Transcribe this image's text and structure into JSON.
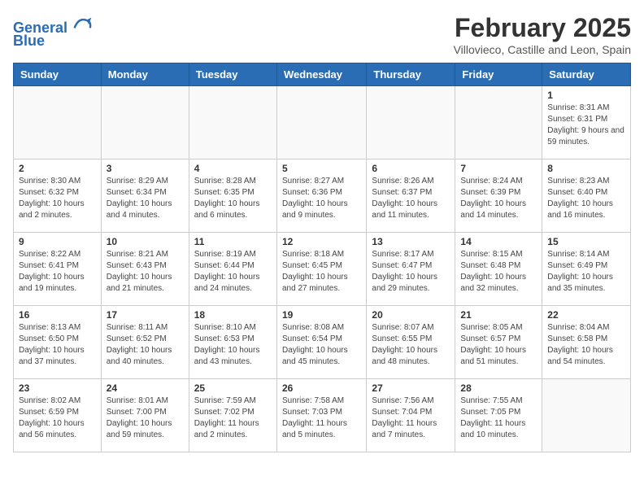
{
  "logo": {
    "line1": "General",
    "line2": "Blue"
  },
  "title": "February 2025",
  "location": "Villovieco, Castille and Leon, Spain",
  "weekdays": [
    "Sunday",
    "Monday",
    "Tuesday",
    "Wednesday",
    "Thursday",
    "Friday",
    "Saturday"
  ],
  "weeks": [
    [
      {
        "day": "",
        "info": ""
      },
      {
        "day": "",
        "info": ""
      },
      {
        "day": "",
        "info": ""
      },
      {
        "day": "",
        "info": ""
      },
      {
        "day": "",
        "info": ""
      },
      {
        "day": "",
        "info": ""
      },
      {
        "day": "1",
        "info": "Sunrise: 8:31 AM\nSunset: 6:31 PM\nDaylight: 9 hours and 59 minutes."
      }
    ],
    [
      {
        "day": "2",
        "info": "Sunrise: 8:30 AM\nSunset: 6:32 PM\nDaylight: 10 hours and 2 minutes."
      },
      {
        "day": "3",
        "info": "Sunrise: 8:29 AM\nSunset: 6:34 PM\nDaylight: 10 hours and 4 minutes."
      },
      {
        "day": "4",
        "info": "Sunrise: 8:28 AM\nSunset: 6:35 PM\nDaylight: 10 hours and 6 minutes."
      },
      {
        "day": "5",
        "info": "Sunrise: 8:27 AM\nSunset: 6:36 PM\nDaylight: 10 hours and 9 minutes."
      },
      {
        "day": "6",
        "info": "Sunrise: 8:26 AM\nSunset: 6:37 PM\nDaylight: 10 hours and 11 minutes."
      },
      {
        "day": "7",
        "info": "Sunrise: 8:24 AM\nSunset: 6:39 PM\nDaylight: 10 hours and 14 minutes."
      },
      {
        "day": "8",
        "info": "Sunrise: 8:23 AM\nSunset: 6:40 PM\nDaylight: 10 hours and 16 minutes."
      }
    ],
    [
      {
        "day": "9",
        "info": "Sunrise: 8:22 AM\nSunset: 6:41 PM\nDaylight: 10 hours and 19 minutes."
      },
      {
        "day": "10",
        "info": "Sunrise: 8:21 AM\nSunset: 6:43 PM\nDaylight: 10 hours and 21 minutes."
      },
      {
        "day": "11",
        "info": "Sunrise: 8:19 AM\nSunset: 6:44 PM\nDaylight: 10 hours and 24 minutes."
      },
      {
        "day": "12",
        "info": "Sunrise: 8:18 AM\nSunset: 6:45 PM\nDaylight: 10 hours and 27 minutes."
      },
      {
        "day": "13",
        "info": "Sunrise: 8:17 AM\nSunset: 6:47 PM\nDaylight: 10 hours and 29 minutes."
      },
      {
        "day": "14",
        "info": "Sunrise: 8:15 AM\nSunset: 6:48 PM\nDaylight: 10 hours and 32 minutes."
      },
      {
        "day": "15",
        "info": "Sunrise: 8:14 AM\nSunset: 6:49 PM\nDaylight: 10 hours and 35 minutes."
      }
    ],
    [
      {
        "day": "16",
        "info": "Sunrise: 8:13 AM\nSunset: 6:50 PM\nDaylight: 10 hours and 37 minutes."
      },
      {
        "day": "17",
        "info": "Sunrise: 8:11 AM\nSunset: 6:52 PM\nDaylight: 10 hours and 40 minutes."
      },
      {
        "day": "18",
        "info": "Sunrise: 8:10 AM\nSunset: 6:53 PM\nDaylight: 10 hours and 43 minutes."
      },
      {
        "day": "19",
        "info": "Sunrise: 8:08 AM\nSunset: 6:54 PM\nDaylight: 10 hours and 45 minutes."
      },
      {
        "day": "20",
        "info": "Sunrise: 8:07 AM\nSunset: 6:55 PM\nDaylight: 10 hours and 48 minutes."
      },
      {
        "day": "21",
        "info": "Sunrise: 8:05 AM\nSunset: 6:57 PM\nDaylight: 10 hours and 51 minutes."
      },
      {
        "day": "22",
        "info": "Sunrise: 8:04 AM\nSunset: 6:58 PM\nDaylight: 10 hours and 54 minutes."
      }
    ],
    [
      {
        "day": "23",
        "info": "Sunrise: 8:02 AM\nSunset: 6:59 PM\nDaylight: 10 hours and 56 minutes."
      },
      {
        "day": "24",
        "info": "Sunrise: 8:01 AM\nSunset: 7:00 PM\nDaylight: 10 hours and 59 minutes."
      },
      {
        "day": "25",
        "info": "Sunrise: 7:59 AM\nSunset: 7:02 PM\nDaylight: 11 hours and 2 minutes."
      },
      {
        "day": "26",
        "info": "Sunrise: 7:58 AM\nSunset: 7:03 PM\nDaylight: 11 hours and 5 minutes."
      },
      {
        "day": "27",
        "info": "Sunrise: 7:56 AM\nSunset: 7:04 PM\nDaylight: 11 hours and 7 minutes."
      },
      {
        "day": "28",
        "info": "Sunrise: 7:55 AM\nSunset: 7:05 PM\nDaylight: 11 hours and 10 minutes."
      },
      {
        "day": "",
        "info": ""
      }
    ]
  ]
}
